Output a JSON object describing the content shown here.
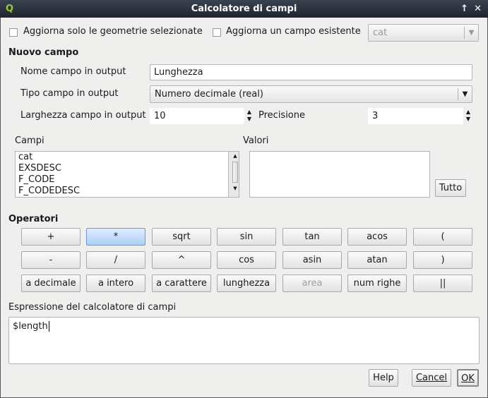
{
  "window": {
    "title": "Calcolatore di campi",
    "icon": "qgis-logo",
    "controls": [
      "↑",
      "✕"
    ]
  },
  "top": {
    "only_selected_label": "Aggiorna solo le geometrie selezionate",
    "update_existing_label": "Aggiorna un campo esistente",
    "existing_field_value": "cat"
  },
  "new_field": {
    "heading": "Nuovo campo",
    "name_label": "Nome campo in output",
    "name_value": "Lunghezza",
    "type_label": "Tipo campo in output",
    "type_value": "Numero decimale (real)",
    "width_label": "Larghezza campo in output",
    "width_value": "10",
    "precision_label": "Precisione",
    "precision_value": "3"
  },
  "fields": {
    "label": "Campi",
    "items": [
      "cat",
      "EXSDESC",
      "F_CODE",
      "F_CODEDESC"
    ]
  },
  "values": {
    "label": "Valori",
    "all_button": "Tutto"
  },
  "operators": {
    "heading": "Operatori",
    "rows": [
      [
        "+",
        "*",
        "sqrt",
        "sin",
        "tan",
        "acos",
        "("
      ],
      [
        "-",
        "/",
        "^",
        "cos",
        "asin",
        "atan",
        ")"
      ],
      [
        "a decimale",
        "a intero",
        "a carattere",
        "lunghezza",
        "area",
        "num righe",
        "||"
      ]
    ],
    "disabled": [
      "area"
    ],
    "hovered": "*"
  },
  "expression": {
    "label": "Espressione del calcolatore di campi",
    "value": "$length"
  },
  "footer": {
    "help": "Help",
    "cancel": "Cancel",
    "ok": "OK"
  }
}
